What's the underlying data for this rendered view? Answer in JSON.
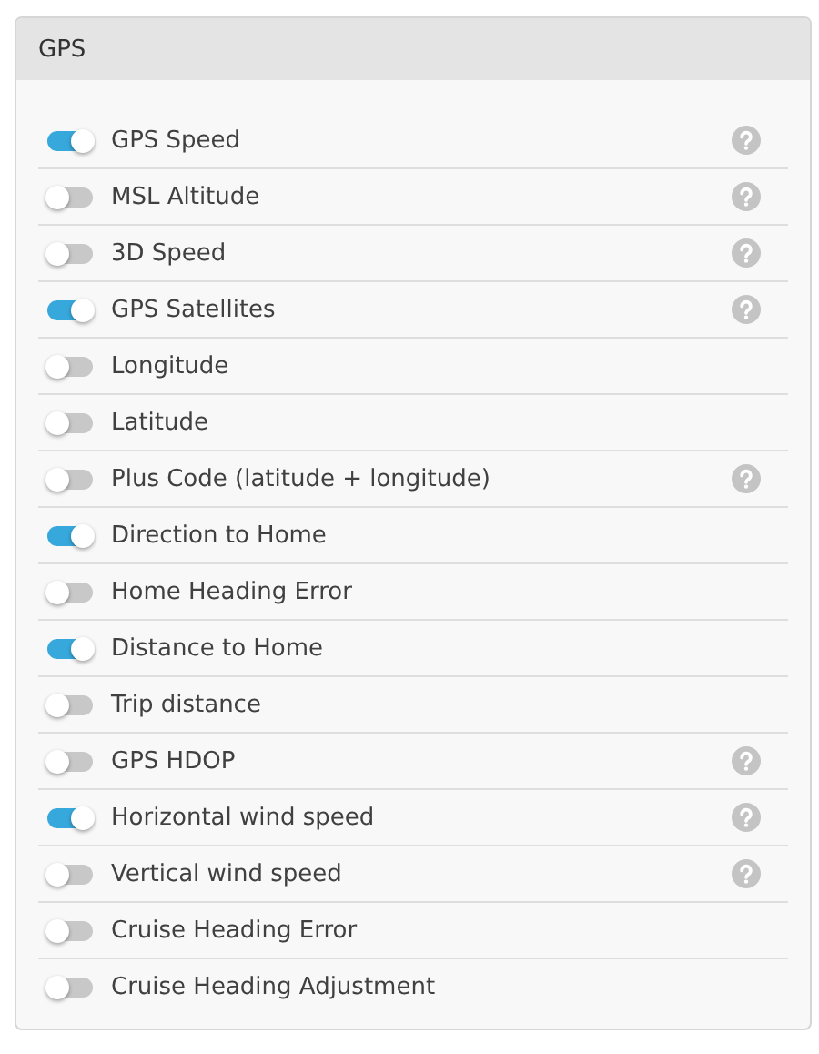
{
  "panel": {
    "title": "GPS"
  },
  "items": [
    {
      "label": "GPS Speed",
      "on": true,
      "help": true
    },
    {
      "label": "MSL Altitude",
      "on": false,
      "help": true
    },
    {
      "label": "3D Speed",
      "on": false,
      "help": true
    },
    {
      "label": "GPS Satellites",
      "on": true,
      "help": true
    },
    {
      "label": "Longitude",
      "on": false,
      "help": false
    },
    {
      "label": "Latitude",
      "on": false,
      "help": false
    },
    {
      "label": "Plus Code (latitude + longitude)",
      "on": false,
      "help": true
    },
    {
      "label": "Direction to Home",
      "on": true,
      "help": false
    },
    {
      "label": "Home Heading Error",
      "on": false,
      "help": false
    },
    {
      "label": "Distance to Home",
      "on": true,
      "help": false
    },
    {
      "label": "Trip distance",
      "on": false,
      "help": false
    },
    {
      "label": "GPS HDOP",
      "on": false,
      "help": true
    },
    {
      "label": "Horizontal wind speed",
      "on": true,
      "help": true
    },
    {
      "label": "Vertical wind speed",
      "on": false,
      "help": true
    },
    {
      "label": "Cruise Heading Error",
      "on": false,
      "help": false
    },
    {
      "label": "Cruise Heading Adjustment",
      "on": false,
      "help": false
    }
  ]
}
